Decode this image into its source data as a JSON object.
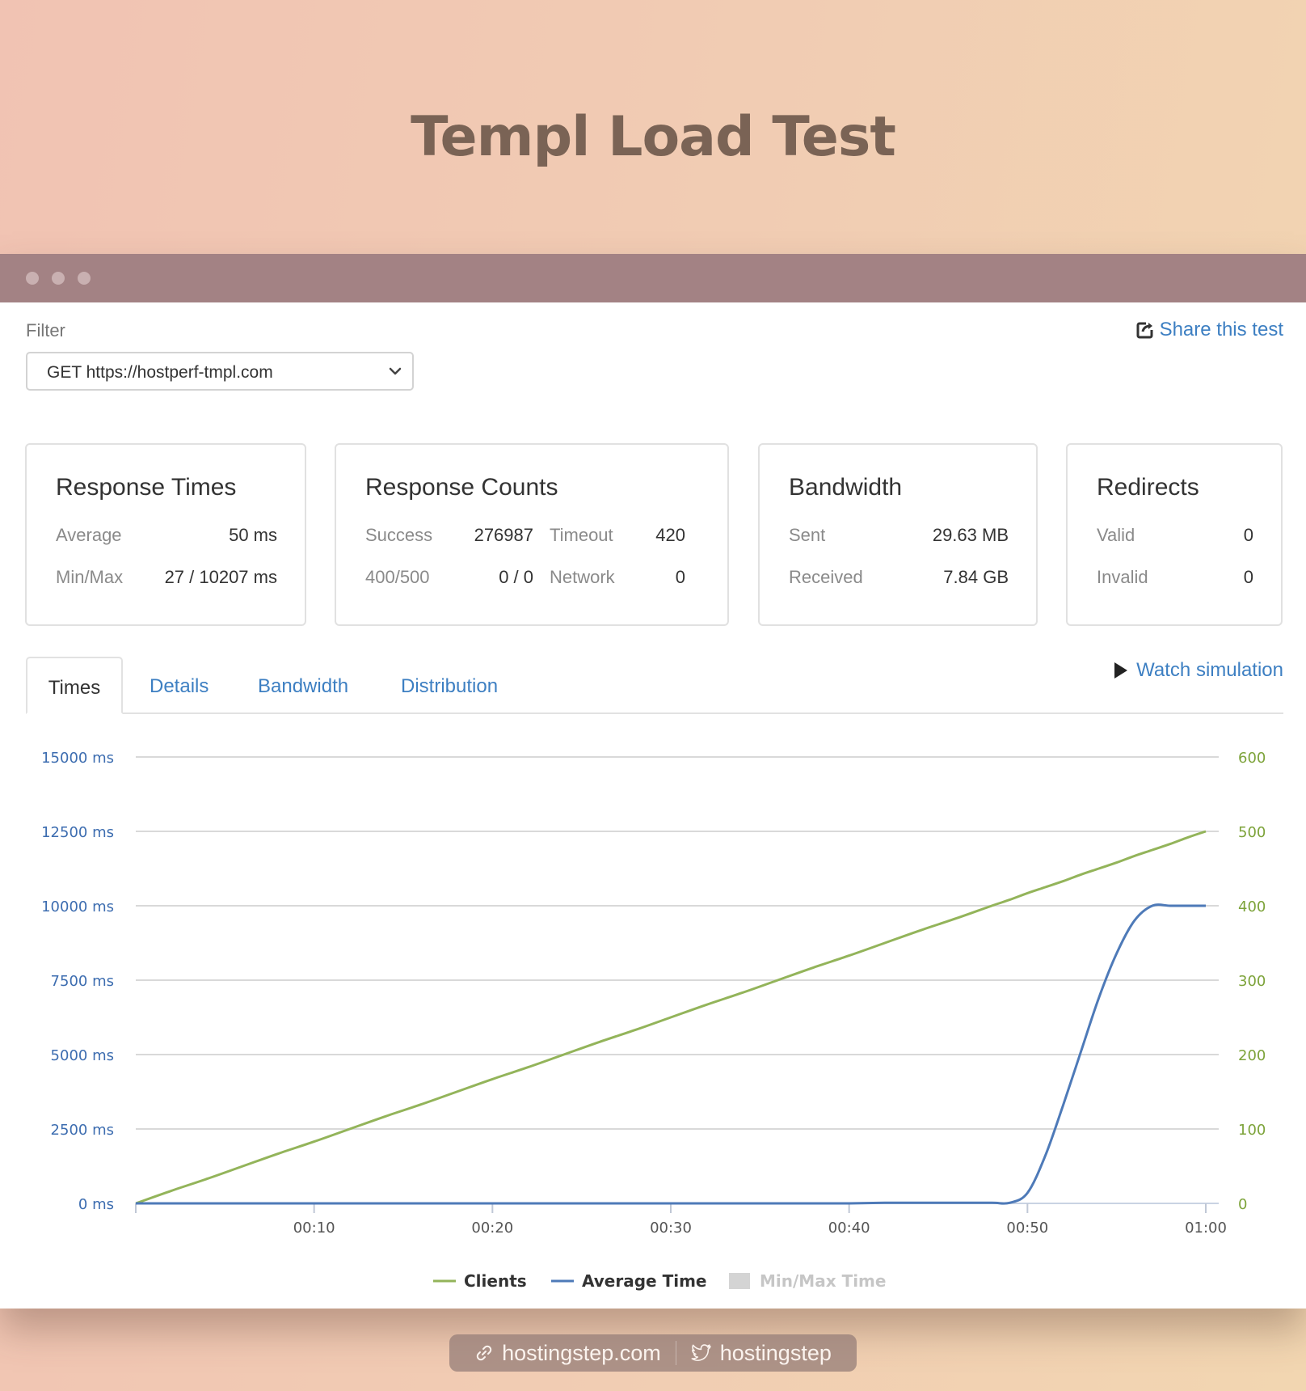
{
  "header": {
    "title": "Templ Load Test"
  },
  "filter": {
    "label": "Filter",
    "selected": "GET https://hostperf-tmpl.com",
    "share_label": "Share this test"
  },
  "cards": {
    "response_times": {
      "title": "Response Times",
      "average_label": "Average",
      "average_value": "50 ms",
      "minmax_label": "Min/Max",
      "minmax_value": "27 / 10207 ms"
    },
    "response_counts": {
      "title": "Response Counts",
      "success_label": "Success",
      "success_value": "276987",
      "timeout_label": "Timeout",
      "timeout_value": "420",
      "http_errors_label": "400/500",
      "http_errors_value": "0 / 0",
      "network_label": "Network",
      "network_value": "0"
    },
    "bandwidth": {
      "title": "Bandwidth",
      "sent_label": "Sent",
      "sent_value": "29.63 MB",
      "received_label": "Received",
      "received_value": "7.84 GB"
    },
    "redirects": {
      "title": "Redirects",
      "valid_label": "Valid",
      "valid_value": "0",
      "invalid_label": "Invalid",
      "invalid_value": "0"
    }
  },
  "tabs": [
    "Times",
    "Details",
    "Bandwidth",
    "Distribution"
  ],
  "watch_label": "Watch simulation",
  "colors": {
    "clients": "#93b45a",
    "average_time": "#4e7ab8",
    "minmax": "#d4d4d4",
    "left_axis": "#3d6db0",
    "right_axis": "#7da33a",
    "link": "#3d7fc2"
  },
  "chart_data": {
    "type": "line",
    "x": [
      "00:00",
      "00:02",
      "00:04",
      "00:06",
      "00:08",
      "00:10",
      "00:12",
      "00:14",
      "00:16",
      "00:18",
      "00:20",
      "00:22",
      "00:24",
      "00:26",
      "00:28",
      "00:30",
      "00:32",
      "00:34",
      "00:36",
      "00:38",
      "00:40",
      "00:42",
      "00:44",
      "00:46",
      "00:48",
      "00:49",
      "00:50",
      "00:51",
      "00:52",
      "00:53",
      "00:54",
      "00:55",
      "00:56",
      "00:57",
      "00:58",
      "00:59",
      "01:00"
    ],
    "x_ticks": [
      "00:10",
      "00:20",
      "00:30",
      "00:40",
      "00:50",
      "01:00"
    ],
    "y_left": {
      "ticks": [
        "0 ms",
        "2500 ms",
        "5000 ms",
        "7500 ms",
        "10000 ms",
        "12500 ms",
        "15000 ms"
      ],
      "range": [
        0,
        15000
      ]
    },
    "y_right": {
      "ticks": [
        "0",
        "100",
        "200",
        "300",
        "400",
        "500",
        "600"
      ],
      "range": [
        0,
        600
      ]
    },
    "series": [
      {
        "name": "Clients",
        "axis": "right",
        "values": [
          0,
          17,
          33,
          50,
          67,
          83,
          100,
          117,
          133,
          150,
          167,
          183,
          200,
          217,
          233,
          250,
          267,
          283,
          300,
          317,
          333,
          350,
          367,
          383,
          400,
          408,
          417,
          425,
          433,
          442,
          450,
          458,
          467,
          475,
          483,
          492,
          500
        ]
      },
      {
        "name": "Average Time",
        "axis": "left",
        "values": [
          0,
          0,
          0,
          0,
          0,
          0,
          0,
          0,
          0,
          0,
          0,
          0,
          0,
          0,
          0,
          0,
          0,
          0,
          0,
          0,
          0,
          20,
          20,
          20,
          20,
          20,
          350,
          1600,
          3300,
          5100,
          6900,
          8400,
          9500,
          10000,
          10000,
          10000,
          10000
        ]
      },
      {
        "name": "Min/Max Time",
        "axis": "left",
        "values": [],
        "hidden": true
      }
    ],
    "legend": [
      "Clients",
      "Average Time",
      "Min/Max Time"
    ],
    "grid": true,
    "legend_position": "bottom"
  },
  "footer": {
    "website": "hostingstep.com",
    "twitter": "hostingstep"
  }
}
